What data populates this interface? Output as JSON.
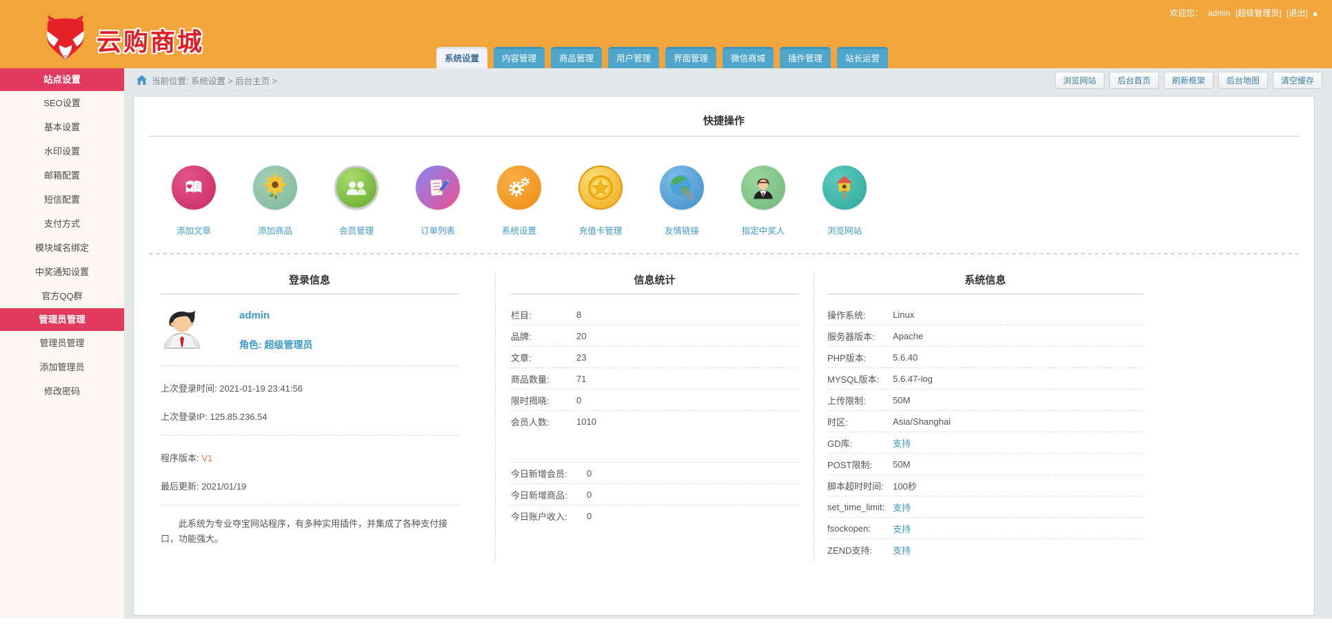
{
  "colors": {
    "header_orange": "#F3A43B",
    "accent_pink": "#E23A5E",
    "tab_blue": "#4EA6CD",
    "link_blue": "#3E9ACB",
    "logo_red": "#E01E25",
    "version_orange": "#F07830"
  },
  "header": {
    "logo_text": "云购商城",
    "welcome_prefix": "欢迎您：",
    "username": "admin",
    "role_bracket": "[超级管理员]",
    "logout": "[退出]",
    "tabs": [
      {
        "label": "系统设置",
        "active": true
      },
      {
        "label": "内容管理",
        "active": false
      },
      {
        "label": "商品管理",
        "active": false
      },
      {
        "label": "用户管理",
        "active": false
      },
      {
        "label": "界面管理",
        "active": false
      },
      {
        "label": "微信商城",
        "active": false
      },
      {
        "label": "插件管理",
        "active": false
      },
      {
        "label": "站长运营",
        "active": false
      }
    ]
  },
  "sidebar": {
    "items": [
      {
        "label": "站点设置",
        "type": "header"
      },
      {
        "label": "SEO设置",
        "type": "item"
      },
      {
        "label": "基本设置",
        "type": "item"
      },
      {
        "label": "水印设置",
        "type": "item"
      },
      {
        "label": "邮箱配置",
        "type": "item"
      },
      {
        "label": "短信配置",
        "type": "item"
      },
      {
        "label": "支付方式",
        "type": "item"
      },
      {
        "label": "模块域名绑定",
        "type": "item"
      },
      {
        "label": "中奖通知设置",
        "type": "item"
      },
      {
        "label": "官方QQ群",
        "type": "item"
      },
      {
        "label": "管理员管理",
        "type": "header"
      },
      {
        "label": "管理员管理",
        "type": "item"
      },
      {
        "label": "添加管理员",
        "type": "item"
      },
      {
        "label": "修改密码",
        "type": "item"
      }
    ]
  },
  "breadcrumb": {
    "location_text": "当前位置: 系统设置 > 后台主页 >",
    "buttons": [
      "浏览网站",
      "后台首页",
      "刷新框架",
      "后台地图",
      "清空缓存"
    ]
  },
  "quick_actions": {
    "title": "快捷操作",
    "items": [
      {
        "label": "添加文章",
        "icon": "article-book-icon"
      },
      {
        "label": "添加商品",
        "icon": "sunflower-icon"
      },
      {
        "label": "会员管理",
        "icon": "members-icon"
      },
      {
        "label": "订单列表",
        "icon": "order-list-icon"
      },
      {
        "label": "系统设置",
        "icon": "gears-icon"
      },
      {
        "label": "充值卡管理",
        "icon": "coin-star-icon"
      },
      {
        "label": "友情链接",
        "icon": "globe-link-icon"
      },
      {
        "label": "指定中奖人",
        "icon": "winner-person-icon"
      },
      {
        "label": "浏览网站",
        "icon": "birdhouse-icon"
      }
    ]
  },
  "login_panel": {
    "title": "登录信息",
    "username": "admin",
    "role_label": "角色: 超级管理员",
    "last_login_time": "上次登录时间: 2021-01-19 23:41:56",
    "last_login_ip": "上次登录IP: 125.85.236.54",
    "version_label": "程序版本:",
    "version_value": "V1",
    "last_update": "最后更新: 2021/01/19",
    "description": "此系统为专业夺宝网站程序，有多种实用插件，并集成了各种支付接口，功能强大。"
  },
  "stats_panel": {
    "title": "信息统计",
    "rows": [
      {
        "label": "栏目:",
        "value": "8"
      },
      {
        "label": "品牌:",
        "value": "20"
      },
      {
        "label": "文章:",
        "value": "23"
      },
      {
        "label": "商品数量:",
        "value": "71"
      },
      {
        "label": "限时揭晓:",
        "value": "0"
      },
      {
        "label": "会员人数:",
        "value": "1010"
      }
    ],
    "today_rows": [
      {
        "label": "今日新增会员:",
        "value": "0"
      },
      {
        "label": "今日新增商品:",
        "value": "0"
      },
      {
        "label": "今日账户收入:",
        "value": "0"
      }
    ]
  },
  "system_panel": {
    "title": "系统信息",
    "rows": [
      {
        "label": "操作系统:",
        "value": "Linux"
      },
      {
        "label": "服务器版本:",
        "value": "Apache"
      },
      {
        "label": "PHP版本:",
        "value": "5.6.40"
      },
      {
        "label": "MYSQL版本:",
        "value": "5.6.47-log"
      },
      {
        "label": "上传限制:",
        "value": "50M"
      },
      {
        "label": "时区:",
        "value": "Asia/Shanghai"
      },
      {
        "label": "GD库:",
        "value": "支持"
      },
      {
        "label": "POST限制:",
        "value": "50M"
      },
      {
        "label": "脚本超时时间:",
        "value": "100秒"
      },
      {
        "label": "set_time_limit:",
        "value": "支持"
      },
      {
        "label": "fsockopen:",
        "value": "支持"
      },
      {
        "label": "ZEND支持:",
        "value": "支持"
      }
    ]
  }
}
